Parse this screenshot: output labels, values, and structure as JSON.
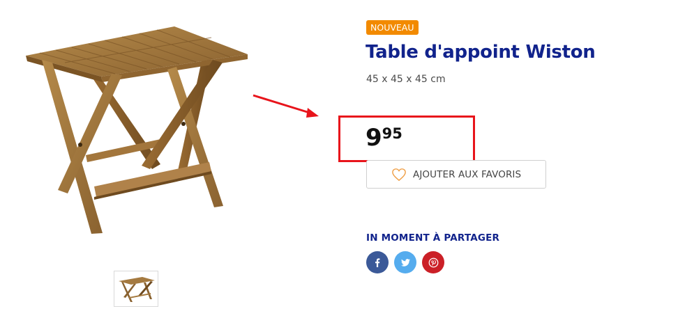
{
  "product": {
    "badge": "NOUVEAU",
    "title": "Table d'appoint Wiston",
    "dimensions": "45 x 45 x 45 cm",
    "price": {
      "integer": "9",
      "decimals": "95"
    }
  },
  "favorites": {
    "label": "AJOUTER AUX FAVORIS"
  },
  "share": {
    "title": "IN MOMENT À PARTAGER",
    "networks": [
      {
        "name": "facebook",
        "icon": "facebook-icon",
        "color": "#3b5998"
      },
      {
        "name": "twitter",
        "icon": "twitter-icon",
        "color": "#55acee"
      },
      {
        "name": "pinterest",
        "icon": "pinterest-icon",
        "color": "#cb2027"
      }
    ]
  },
  "colors": {
    "brand": "#11238c",
    "badge": "#f28a00",
    "annotation": "#e8141b"
  }
}
